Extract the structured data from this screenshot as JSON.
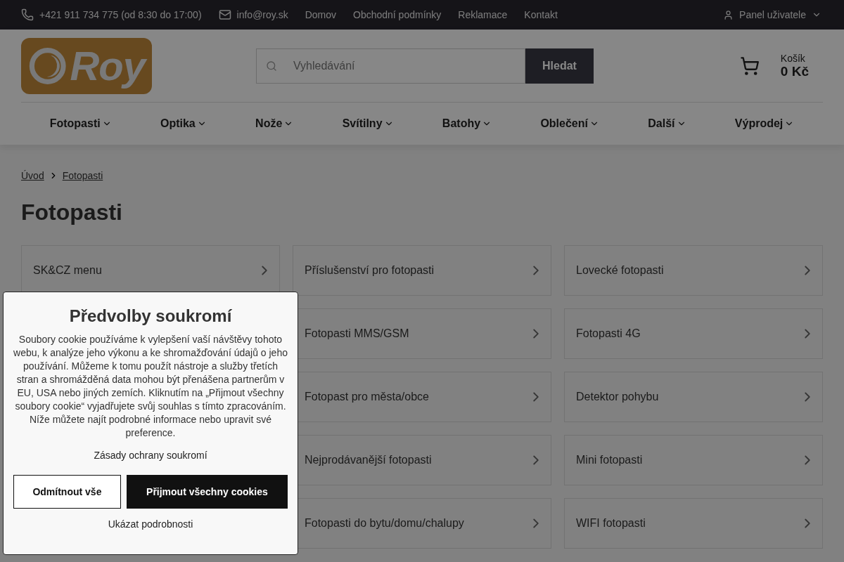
{
  "top_bar": {
    "phone": "+421 911 734 775 (od 8:30 do 17:00)",
    "email": "info@roy.sk",
    "links": [
      "Domov",
      "Obchodní podmínky",
      "Reklamace",
      "Kontakt"
    ],
    "user_panel": "Panel uživatele"
  },
  "header": {
    "logo": "Roy",
    "search": {
      "placeholder": "Vyhledávání",
      "button": "Hledat"
    },
    "cart": {
      "label": "Košík",
      "total": "0 Kč"
    }
  },
  "nav": [
    "Fotopasti",
    "Optika",
    "Nože",
    "Svítilny",
    "Batohy",
    "Oblečení",
    "Další",
    "Výprodej"
  ],
  "breadcrumb": [
    "Úvod",
    "Fotopasti"
  ],
  "title": "Fotopasti",
  "categories": [
    {
      "label": "SK&CZ menu"
    },
    {
      "label": "Příslušenství pro fotopasti"
    },
    {
      "label": "Lovecké fotopasti"
    },
    {
      "label": "Fotopasti MMS/GSM"
    },
    {
      "label": "Fotopasti 4G"
    },
    {
      "label": "Fotopast pro města/obce"
    },
    {
      "label": "Detektor pohybu"
    },
    {
      "label": "Nejprodávanější fotopasti"
    },
    {
      "label": "Mini fotopasti"
    },
    {
      "label": "Fotopasti do bytu/domu/chalupy"
    },
    {
      "label": "WIFI fotopasti"
    }
  ],
  "cookie_dialog": {
    "title": "Předvolby soukromí",
    "text": "Soubory cookie používáme k vylepšení vaší návštěvy tohoto webu, k analýze jeho výkonu a ke shromažďování údajů o jeho používání. Můžeme k tomu použít nástroje a služby třetích stran a shromážděná data mohou být přenášena partnerům v EU, USA nebo jiných zemích. Kliknutím na „Přijmout všechny soubory cookie“ vyjadřujete svůj souhlas s tímto zpracováním. Níže můžete najít podrobné informace nebo upravit své preference.",
    "policy_link": "Zásady ochrany soukromí",
    "reject": "Odmítnout vše",
    "accept": "Přijmout všechny cookies",
    "details": "Ukázat podrobnosti"
  }
}
